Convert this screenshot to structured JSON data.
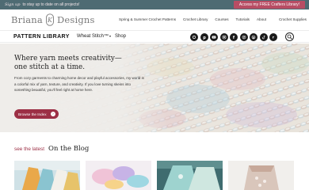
{
  "topbar": {
    "signup_label": "Sign up",
    "stay_text": "to stay up to date on all projects!",
    "promo_button": "Access my FREE Crafters Library!"
  },
  "header": {
    "brand_left": "Briana",
    "brand_right": "Designs",
    "nav": [
      "Spring & Summer Crochet Patterns",
      "Crochet Library",
      "Courses",
      "Tutorials",
      "About",
      "Crochet Supplies"
    ]
  },
  "subnav": {
    "pattern_library": "PATTERN LIBRARY",
    "wheat_stitch": "Wheat Stitch™",
    "shop": "Shop",
    "social_icons": [
      "threads-icon",
      "pinterest-icon",
      "youtube-icon",
      "instagram-icon",
      "facebook-icon",
      "facebook-icon",
      "pinterest-icon",
      "tiktok-icon",
      "ravelry-icon"
    ]
  },
  "hero": {
    "title": "Where yarn meets creativity—one stitch at a time.",
    "body_main": "From cozy garments to charming home decor and playful accessories, my world is a colorful mix of yarn, texture, and creativity. If you love turning skeins into ",
    "body_em": "something beautiful",
    "body_end": ", you'll feel right at home here.",
    "button_label": "Browse the Index"
  },
  "blog": {
    "see_label": "see the latest",
    "title": "On the Blog"
  },
  "colors": {
    "accent": "#9c2f45",
    "promo": "#b84d64",
    "topbar": "#4e6b73"
  }
}
